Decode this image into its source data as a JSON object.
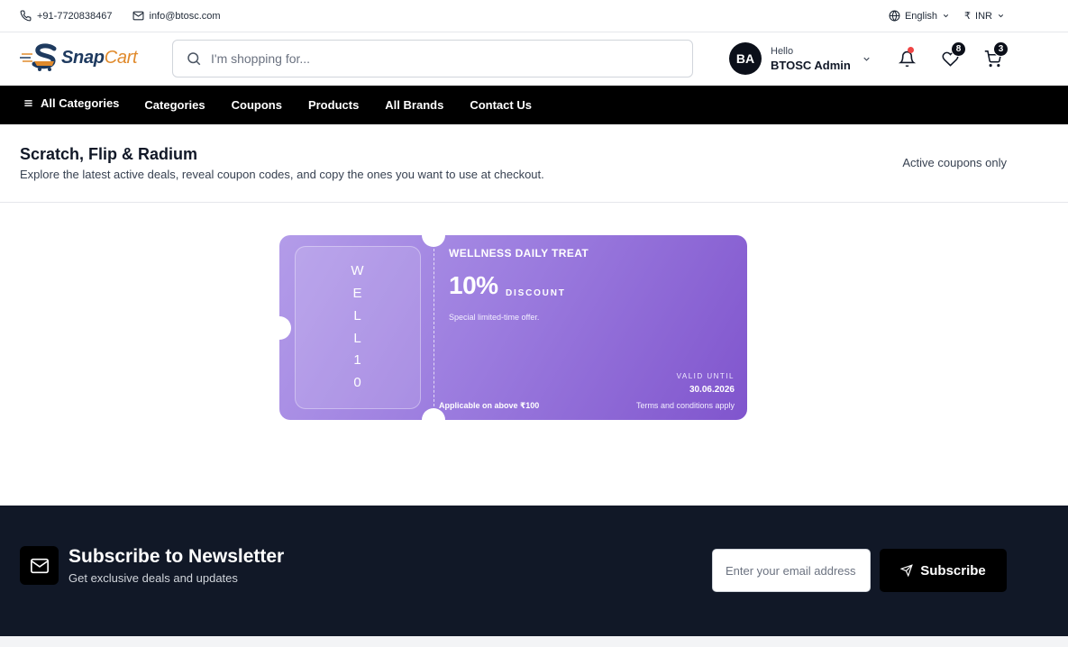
{
  "topbar": {
    "phone": "+91-7720838467",
    "email": "info@btosc.com",
    "language": "English",
    "currency_symbol": "₹",
    "currency": "INR"
  },
  "header": {
    "logo_snap": "Snap",
    "logo_cart": "Cart",
    "search_placeholder": "I'm shopping for...",
    "user": {
      "initials": "BA",
      "greeting": "Hello",
      "name": "BTOSC Admin"
    },
    "wishlist_count": "8",
    "cart_count": "3",
    "icons": [
      "phone-icon",
      "mail-icon",
      "globe-icon",
      "search-icon",
      "bell-icon",
      "heart-icon",
      "cart-icon"
    ]
  },
  "nav": {
    "all_categories": "All Categories",
    "links": [
      "Categories",
      "Coupons",
      "Products",
      "All Brands",
      "Contact Us"
    ]
  },
  "page": {
    "title": "Scratch, Flip & Radium",
    "subtitle": "Explore the latest active deals, reveal coupon codes, and copy the ones you want to use at checkout.",
    "filter_label": "Active coupons only"
  },
  "coupon": {
    "code_chars": [
      "W",
      "E",
      "L",
      "L",
      "1",
      "0"
    ],
    "title": "WELLNESS DAILY TREAT",
    "discount": "10%",
    "discount_label": "DISCOUNT",
    "description": "Special limited-time offer.",
    "valid_label": "VALID UNTIL",
    "valid_date": "30.06.2026",
    "min_order": "Applicable on above ₹100",
    "terms": "Terms and conditions apply",
    "colors": {
      "gradient_start": "#b39ce9",
      "gradient_end": "#8055cd"
    }
  },
  "newsletter": {
    "title": "Subscribe to Newsletter",
    "subtitle": "Get exclusive deals and updates",
    "email_placeholder": "Enter your email address",
    "button_label": "Subscribe"
  },
  "colors": {
    "nav_bg": "#000000",
    "newsletter_bg": "#111827",
    "notification_dot": "#ef4444",
    "logo_orange": "#e08a2c",
    "logo_navy": "#1e3a5f"
  }
}
